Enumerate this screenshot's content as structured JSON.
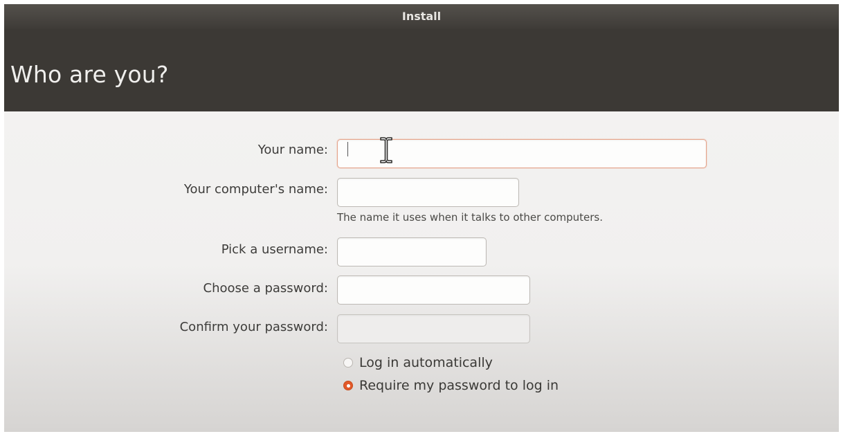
{
  "window": {
    "title": "Install"
  },
  "header": {
    "title": "Who are you?"
  },
  "form": {
    "name_label": "Your name:",
    "name_value": "",
    "computer_name_label": "Your computer's name:",
    "computer_name_value": "",
    "computer_name_hint": "The name it uses when it talks to other computers.",
    "username_label": "Pick a username:",
    "username_value": "",
    "password_label": "Choose a password:",
    "password_value": "",
    "confirm_label": "Confirm your password:",
    "confirm_value": ""
  },
  "login_options": {
    "items": [
      {
        "label": "Log in automatically",
        "selected": false
      },
      {
        "label": "Require my password to log in",
        "selected": true
      }
    ]
  },
  "colors": {
    "accent": "#e2592a",
    "header_bg": "#3c3935",
    "titlebar_bg": "#4a4742"
  },
  "icons": {
    "cursor": "i-beam-cursor-icon",
    "radio_on": "radio-selected-icon",
    "radio_off": "radio-unselected-icon"
  }
}
